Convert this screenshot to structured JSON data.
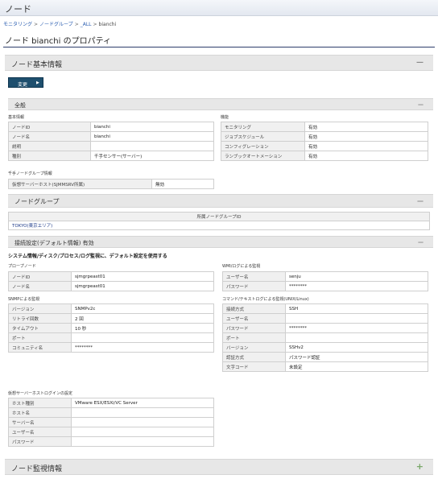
{
  "window": {
    "title": "ノード"
  },
  "breadcrumb": {
    "items": [
      "モニタリング",
      "ノードグループ",
      "_ALL",
      "bianchi"
    ]
  },
  "page": {
    "title": "ノード bianchi のプロパティ"
  },
  "basic": {
    "title": "ノード基本情報",
    "toggle": "—",
    "change_button": "変更"
  },
  "general": {
    "title": "全般",
    "toggle": "—",
    "basic_label": "基本情報",
    "basic_rows": [
      {
        "k": "ノードID",
        "v": "bianchi"
      },
      {
        "k": "ノード名",
        "v": "bianchi"
      },
      {
        "k": "説明",
        "v": ""
      },
      {
        "k": "種別",
        "v": "千手センサー(サーバー)"
      }
    ],
    "function_label": "機能",
    "function_rows": [
      {
        "k": "モニタリング",
        "v": "有効"
      },
      {
        "k": "ジョブスケジュール",
        "v": "有効"
      },
      {
        "k": "コンフィグレーション",
        "v": "有効"
      },
      {
        "k": "ランブックオートメーション",
        "v": "有効"
      }
    ],
    "senju_group_label": "千手ノードグループ情報",
    "senju_group_rows": [
      {
        "k": "仮想サーバーホスト(SJMMSRV所属)",
        "v": "無効"
      }
    ]
  },
  "node_group": {
    "title": "ノードグループ",
    "toggle": "—",
    "header": "所属ノードグループID",
    "items": [
      "TOKYO(東京エリア)"
    ]
  },
  "connection": {
    "title": "接続設定(デフォルト情報) 有効",
    "toggle": "—",
    "system_note": "システム情報/ディスク/プロセス/ログ監視に、デフォルト設定を使用する",
    "proxy_label": "プロープノード",
    "proxy_rows": [
      {
        "k": "ノードID",
        "v": "sjmgrpeast01"
      },
      {
        "k": "ノード名",
        "v": "sjmgrpeast01"
      }
    ],
    "wmi_label": "WMI/ログによる監視",
    "wmi_rows": [
      {
        "k": "ユーザー名",
        "v": "senju"
      },
      {
        "k": "パスワード",
        "v": "********"
      }
    ],
    "snmp_label": "SNMPによる監視",
    "snmp_rows": [
      {
        "k": "バージョン",
        "v": "SNMPv2c"
      },
      {
        "k": "リトライ回数",
        "v": "2 回"
      },
      {
        "k": "タイムアウト",
        "v": "10 秒"
      },
      {
        "k": "ポート",
        "v": ""
      },
      {
        "k": "コミュニティ名",
        "v": "********"
      }
    ],
    "command_label": "コマンド/テキストログによる監視(UNIX/Linux)",
    "command_rows": [
      {
        "k": "接続方式",
        "v": "SSH"
      },
      {
        "k": "ユーザー名",
        "v": ""
      },
      {
        "k": "パスワード",
        "v": "********"
      },
      {
        "k": "ポート",
        "v": ""
      },
      {
        "k": "バージョン",
        "v": "SSHv2"
      },
      {
        "k": "認証方式",
        "v": "パスワード認証"
      },
      {
        "k": "文字コード",
        "v": "未設定"
      }
    ],
    "vhost_label": "仮想サーバーホストログインの設定",
    "vhost_rows": [
      {
        "k": "ホスト種別",
        "v": "VMware ESX/ESXi/VC Server"
      },
      {
        "k": "ホスト名",
        "v": ""
      },
      {
        "k": "サーバー名",
        "v": ""
      },
      {
        "k": "ユーザー名",
        "v": ""
      },
      {
        "k": "パスワード",
        "v": ""
      }
    ]
  },
  "monitor": {
    "title": "ノード監視情報",
    "toggle": "+"
  }
}
